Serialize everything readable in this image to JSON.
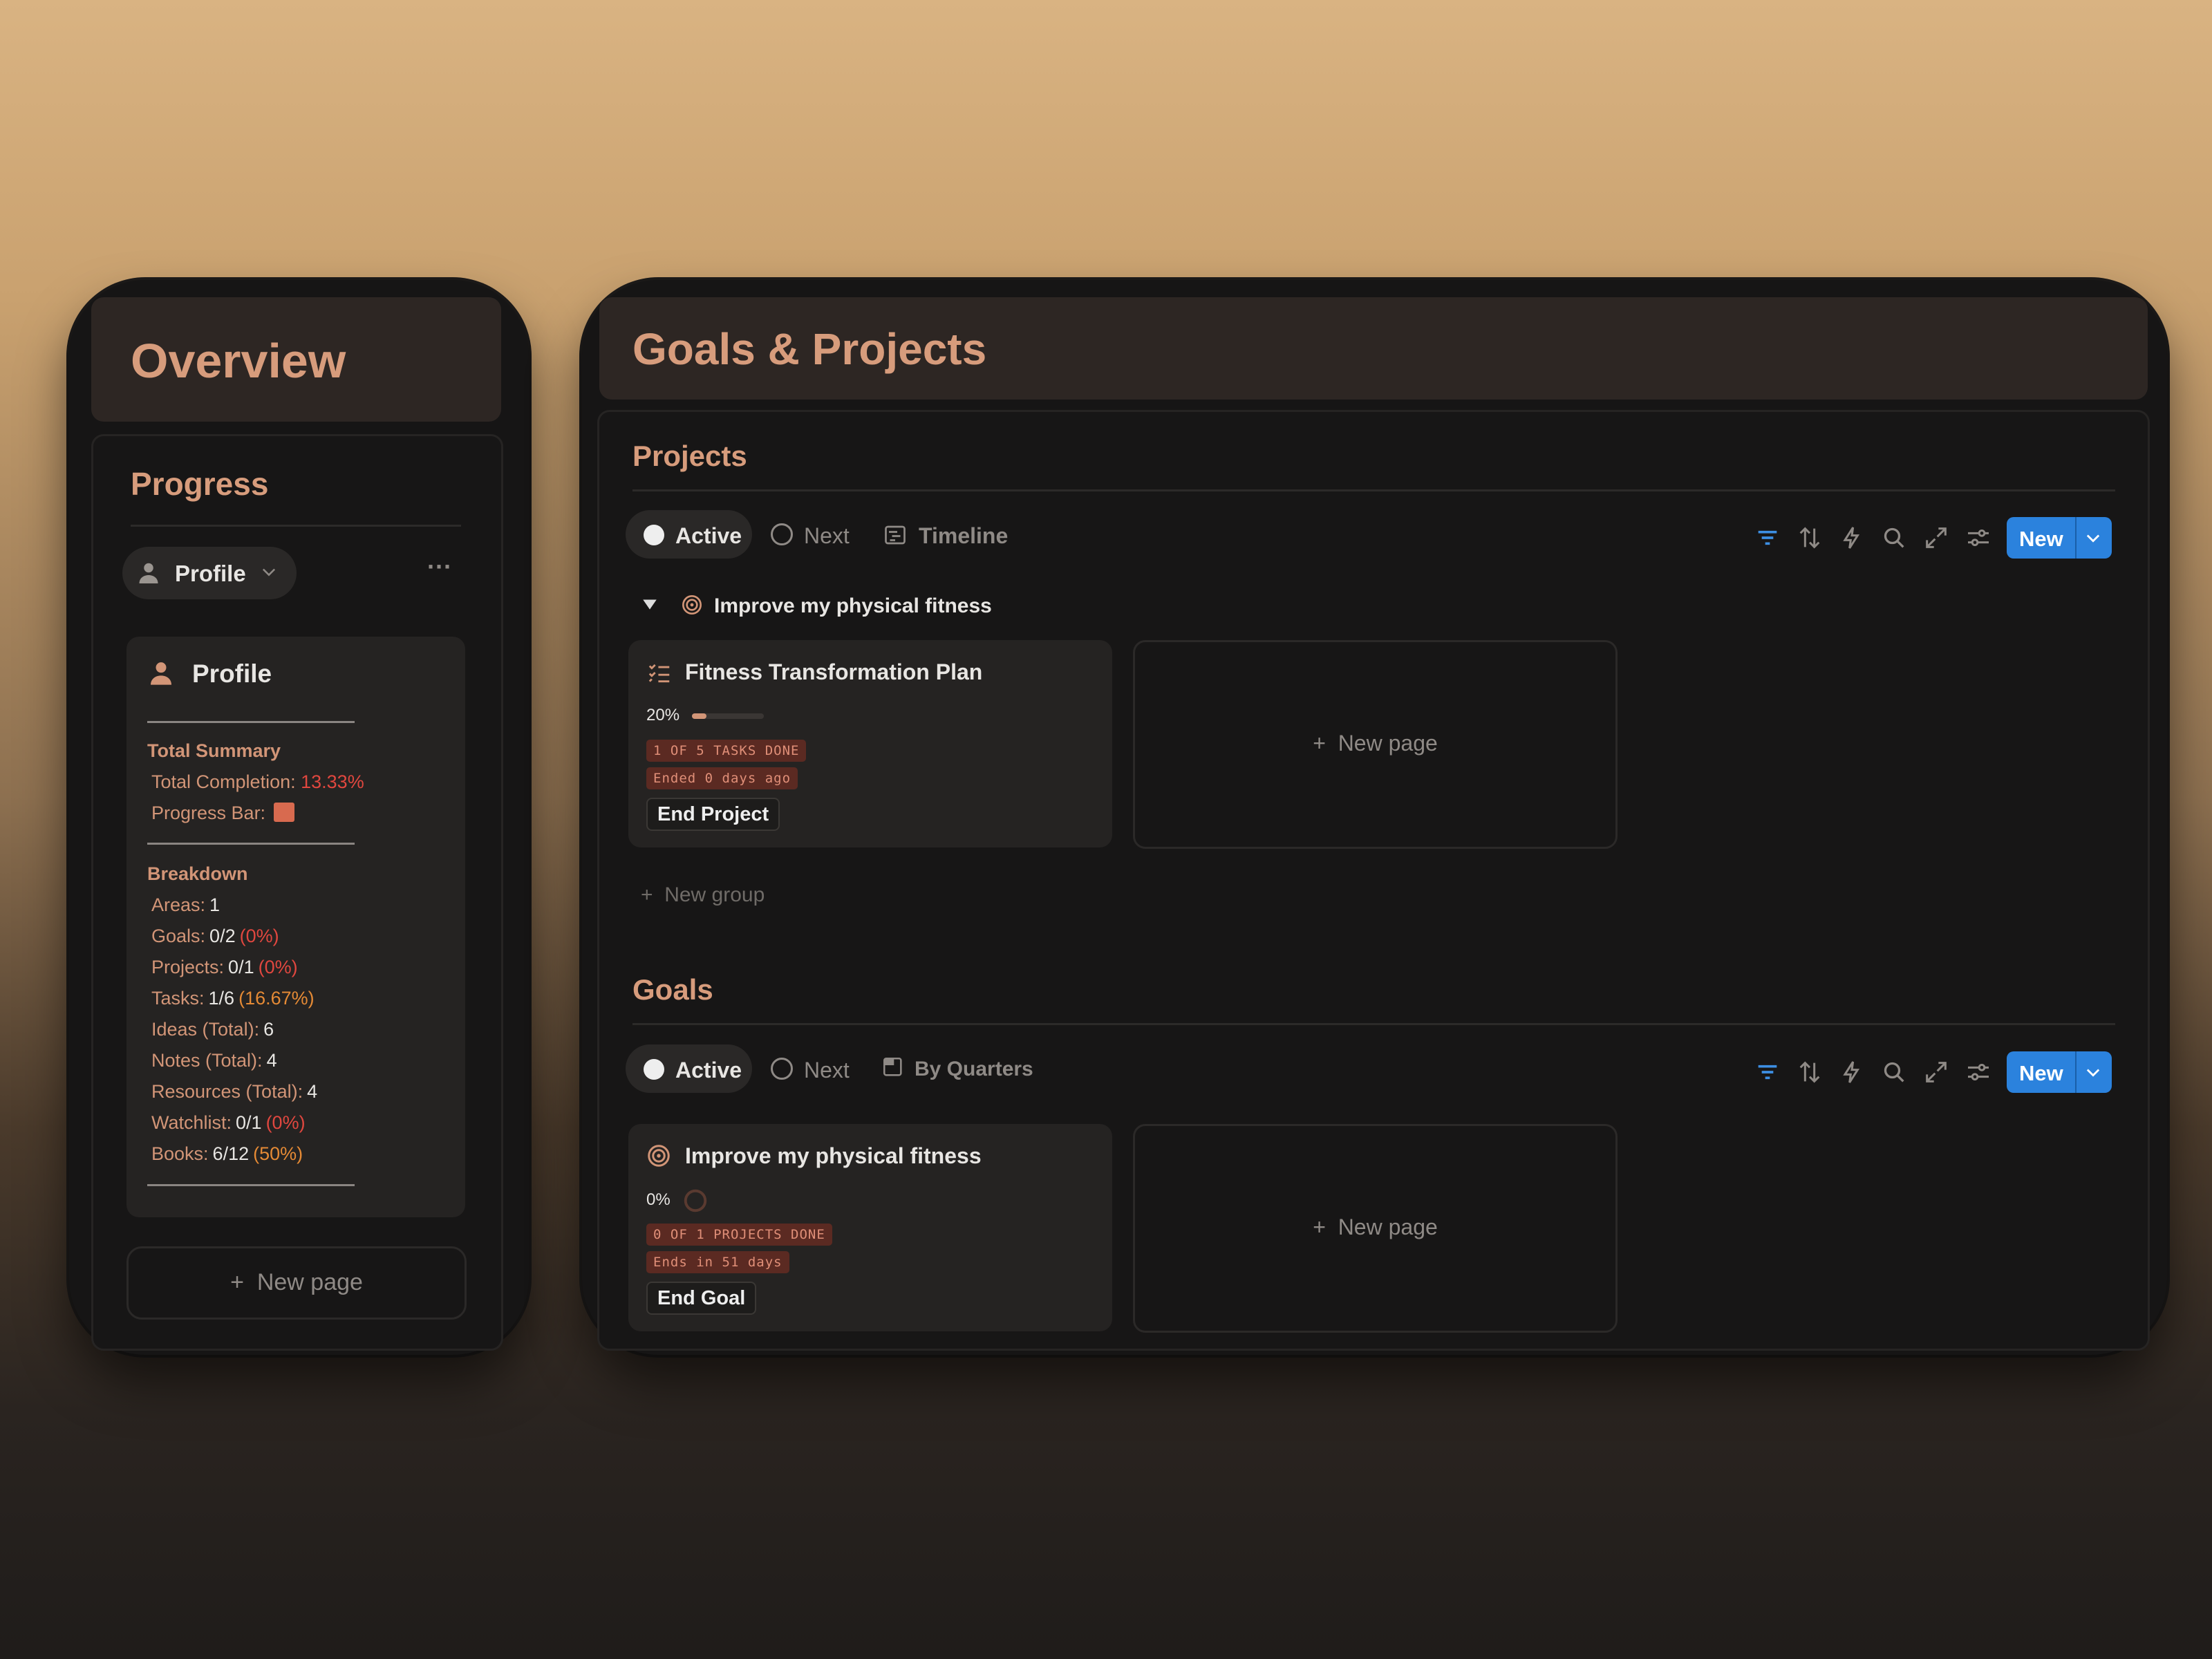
{
  "overview": {
    "title": "Overview",
    "progress_heading": "Progress",
    "view_selector": "Profile",
    "more_label": "···",
    "card_title": "Profile",
    "total_summary_heading": "Total Summary",
    "total_completion_label": "Total Completion:",
    "total_completion_value": "13.33%",
    "progress_bar_label": "Progress Bar:",
    "breakdown_heading": "Breakdown",
    "breakdown": [
      {
        "label": "Areas:",
        "value": "1",
        "pct": ""
      },
      {
        "label": "Goals:",
        "value": "0/2",
        "pct": "(0%)"
      },
      {
        "label": "Projects:",
        "value": "0/1",
        "pct": "(0%)"
      },
      {
        "label": "Tasks:",
        "value": "1/6",
        "pct": "(16.67%)"
      },
      {
        "label": "Ideas (Total):",
        "value": "6",
        "pct": ""
      },
      {
        "label": "Notes (Total):",
        "value": "4",
        "pct": ""
      },
      {
        "label": "Resources (Total):",
        "value": "4",
        "pct": ""
      },
      {
        "label": "Watchlist:",
        "value": "0/1",
        "pct": "(0%)"
      },
      {
        "label": "Books:",
        "value": "6/12",
        "pct": "(50%)"
      }
    ],
    "new_page": "New page",
    "colors": {
      "accent": "#d29577",
      "red": "#e0473f",
      "orange": "#e58a35"
    }
  },
  "goals_projects": {
    "title": "Goals & Projects",
    "projects": {
      "heading": "Projects",
      "tabs": [
        {
          "label": "Active",
          "icon": "filled-circle-icon",
          "active": true
        },
        {
          "label": "Next",
          "icon": "empty-circle-icon",
          "active": false
        },
        {
          "label": "Timeline",
          "icon": "timeline-icon",
          "active": false
        }
      ],
      "new_label": "New",
      "group_name": "Improve my physical fitness",
      "card": {
        "title": "Fitness Transformation Plan",
        "progress_text": "20%",
        "progress_value": 0.2,
        "tags": [
          "1 OF 5 TASKS DONE",
          "Ended 0 days ago"
        ],
        "button": "End Project"
      },
      "new_page": "New page",
      "new_group": "New group"
    },
    "goals": {
      "heading": "Goals",
      "tabs": [
        {
          "label": "Active",
          "icon": "filled-circle-icon",
          "active": true
        },
        {
          "label": "Next",
          "icon": "empty-circle-icon",
          "active": false
        },
        {
          "label": "By Quarters",
          "icon": "calendar-icon",
          "active": false
        }
      ],
      "new_label": "New",
      "card": {
        "title": "Improve my physical fitness",
        "progress_text": "0%",
        "progress_value": 0,
        "tags": [
          "0 OF 1 PROJECTS DONE",
          "Ends in 51 days"
        ],
        "button": "End Goal"
      },
      "new_page": "New page"
    },
    "toolbar_icons": [
      "filter-icon",
      "sort-icon",
      "automation-icon",
      "search-icon",
      "expand-icon",
      "settings-icon"
    ],
    "colors": {
      "button": "#2b82dd",
      "toolbar_icon_active": "#3d8fe3"
    }
  }
}
